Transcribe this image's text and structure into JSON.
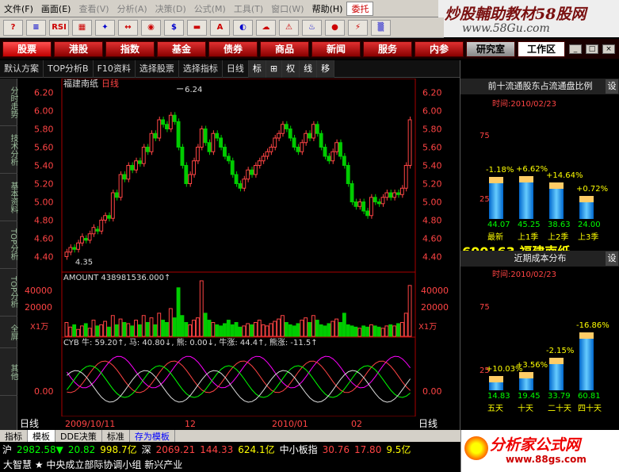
{
  "menu": [
    "文件(F)",
    "画面(E)",
    "查看(V)",
    "分析(A)",
    "决策(D)",
    "公式(M)",
    "工具(T)",
    "窗口(W)",
    "帮助(H)",
    "委托"
  ],
  "watermark": {
    "line1": "炒股輔助教材58股网",
    "line2": "www.58Gu.com"
  },
  "toolbar": {
    "icons": [
      "?",
      "≡",
      "RSI",
      "▦",
      "✦",
      "↔",
      "◉",
      "$",
      "▬",
      "A",
      "◐",
      "☁",
      "⚠",
      "♨",
      "●",
      "⚡",
      "▒"
    ]
  },
  "categories": [
    "股票",
    "港股",
    "指数",
    "基金",
    "债券",
    "商品",
    "新闻",
    "服务",
    "内参",
    "研究室",
    "工作区"
  ],
  "tabs": [
    "默认方案",
    "TOP分析B",
    "F10资料",
    "选择股票",
    "选择指标",
    "日线",
    "标",
    "⊞",
    "权",
    "线",
    "移"
  ],
  "left_side": [
    "分时走势",
    "技术分析",
    "基本资料",
    "TOP分析",
    "TOP分析",
    "全屏",
    "其他"
  ],
  "chart": {
    "stock_title": "福建南纸",
    "period": "日线",
    "max_label": "6.24",
    "min_label": "4.35",
    "price_axis": [
      "6.20",
      "6.00",
      "5.80",
      "5.60",
      "5.40",
      "5.20",
      "5.00",
      "4.80",
      "4.60",
      "4.40"
    ],
    "amount_label": "AMOUNT 438981536.000↑",
    "amount_axis": [
      "40000",
      "20000"
    ],
    "amount_unit": "X1万",
    "cyb_label": "CYB 牛: 59.20↑, 马: 40.80↓, 熊: 0.00↓, 牛涨: 44.4↑, 熊涨: -11.5↑",
    "cyb_axis": "0.00",
    "dates": [
      "2009/10/11",
      "12",
      "2010/01",
      "02"
    ],
    "daily_label": "日线"
  },
  "chart_data": {
    "type": "candlestick",
    "ylim": [
      4.3,
      6.3
    ],
    "candles": [
      [
        4.4,
        4.45
      ],
      [
        4.45,
        4.5
      ],
      [
        4.5,
        4.48
      ],
      [
        4.48,
        4.55
      ],
      [
        4.55,
        4.62
      ],
      [
        4.6,
        4.58
      ],
      [
        4.58,
        4.65
      ],
      [
        4.65,
        4.72
      ],
      [
        4.7,
        4.68
      ],
      [
        4.68,
        4.8
      ],
      [
        4.8,
        4.85
      ],
      [
        4.85,
        4.82
      ],
      [
        4.82,
        5.1
      ],
      [
        5.1,
        5.05
      ],
      [
        5.05,
        5.3
      ],
      [
        5.3,
        5.25
      ],
      [
        5.25,
        5.4
      ],
      [
        5.4,
        5.35
      ],
      [
        5.35,
        5.45
      ],
      [
        5.45,
        5.42
      ],
      [
        5.42,
        5.6
      ],
      [
        5.6,
        5.55
      ],
      [
        5.55,
        5.75
      ],
      [
        5.75,
        5.7
      ],
      [
        5.7,
        5.9
      ],
      [
        5.9,
        5.85
      ],
      [
        5.85,
        5.8
      ],
      [
        5.8,
        5.95
      ],
      [
        5.95,
        5.88
      ],
      [
        5.88,
        5.6
      ],
      [
        5.6,
        5.4
      ],
      [
        5.4,
        5.2
      ],
      [
        5.2,
        5.3
      ],
      [
        5.3,
        5.45
      ],
      [
        5.45,
        5.6
      ],
      [
        5.6,
        5.8
      ],
      [
        5.8,
        5.65
      ],
      [
        5.65,
        5.55
      ],
      [
        5.55,
        5.75
      ],
      [
        5.75,
        5.7
      ],
      [
        5.7,
        5.6
      ],
      [
        5.6,
        5.5
      ],
      [
        5.5,
        5.45
      ],
      [
        5.45,
        5.3
      ],
      [
        5.3,
        5.2
      ],
      [
        5.2,
        5.15
      ],
      [
        5.15,
        5.25
      ],
      [
        5.25,
        5.35
      ],
      [
        5.35,
        5.3
      ],
      [
        5.3,
        5.4
      ],
      [
        5.4,
        5.45
      ],
      [
        5.45,
        5.5
      ],
      [
        5.5,
        5.55
      ],
      [
        5.55,
        5.6
      ],
      [
        5.6,
        5.7
      ],
      [
        5.7,
        5.75
      ],
      [
        5.75,
        5.85
      ],
      [
        5.85,
        5.8
      ],
      [
        5.8,
        5.7
      ],
      [
        5.7,
        5.6
      ],
      [
        5.6,
        5.55
      ],
      [
        5.55,
        5.65
      ],
      [
        5.65,
        5.75
      ],
      [
        5.75,
        5.7
      ],
      [
        5.7,
        5.85
      ],
      [
        5.85,
        5.75
      ],
      [
        5.75,
        5.6
      ],
      [
        5.6,
        5.5
      ],
      [
        5.5,
        5.45
      ],
      [
        5.45,
        5.55
      ],
      [
        5.55,
        5.65
      ],
      [
        5.65,
        5.5
      ],
      [
        5.5,
        5.4
      ],
      [
        5.4,
        5.2
      ],
      [
        5.2,
        5.0
      ],
      [
        5.0,
        4.95
      ],
      [
        4.95,
        5.0
      ],
      [
        5.0,
        4.9
      ],
      [
        4.9,
        4.85
      ],
      [
        4.85,
        5.05
      ],
      [
        5.05,
        5.0
      ],
      [
        5.0,
        4.98
      ],
      [
        4.98,
        5.05
      ],
      [
        5.05,
        5.1
      ],
      [
        5.1,
        5.05
      ],
      [
        5.05,
        5.1
      ],
      [
        5.1,
        5.08
      ],
      [
        5.08,
        5.15
      ],
      [
        5.15,
        5.4
      ],
      [
        5.4,
        5.9
      ]
    ],
    "amount": [
      12,
      8,
      10,
      6,
      9,
      11,
      7,
      14,
      9,
      10,
      13,
      8,
      18,
      10,
      15,
      12,
      11,
      9,
      14,
      10,
      18,
      12,
      16,
      10,
      20,
      14,
      12,
      24,
      16,
      42,
      18,
      12,
      10,
      14,
      16,
      48,
      20,
      14,
      12,
      10,
      9,
      11,
      14,
      10,
      12,
      8,
      9,
      11,
      10,
      12,
      14,
      10,
      9,
      11,
      13,
      15,
      18,
      12,
      10,
      9,
      11,
      14,
      16,
      12,
      18,
      14,
      10,
      9,
      11,
      13,
      15,
      12,
      20,
      10,
      9,
      8,
      7,
      9,
      8,
      10,
      9,
      8,
      7,
      9,
      10,
      9,
      11,
      12,
      20,
      44
    ]
  },
  "right": {
    "panel1_title": "前十流通股东占流通盘比例",
    "panel1_set": "设",
    "panel1_time": "时间:2010/02/23",
    "panel1_axis": [
      "75",
      "25"
    ],
    "panel1_bars": [
      {
        "pct": "-1.18%",
        "val": "44.07",
        "lab": "最新"
      },
      {
        "pct": "+6.62%",
        "val": "45.25",
        "lab": "上1季"
      },
      {
        "pct": "+14.64%",
        "val": "38.63",
        "lab": "上2季"
      },
      {
        "pct": "+0.72%",
        "val": "24.00",
        "lab": "上3季"
      }
    ],
    "ratio": [
      "比",
      "例"
    ],
    "code": "600163",
    "name": "福建南纸",
    "panel2_title": "近期成本分布",
    "panel2_set": "设",
    "panel2_time": "时间:2010/02/23",
    "panel2_axis": [
      "75",
      "25"
    ],
    "panel2_bars": [
      {
        "pct": "+10.03%",
        "val": "14.83",
        "lab": "五天"
      },
      {
        "pct": "+3.56%",
        "val": "19.45",
        "lab": "十天"
      },
      {
        "pct": "-2.15%",
        "val": "33.79",
        "lab": "二十天"
      },
      {
        "pct": "-16.86%",
        "val": "60.81",
        "lab": "四十天"
      }
    ],
    "ratio2": [
      "比",
      "时"
    ]
  },
  "status": {
    "tabs": [
      "指标",
      "模板",
      "DDE决策",
      "标准",
      "存为模板"
    ],
    "row2": [
      {
        "t": "沪",
        "c": "#fff"
      },
      {
        "t": "2982.58▼",
        "c": "#0f0"
      },
      {
        "t": "20.82",
        "c": "#0f0"
      },
      {
        "t": "998.7亿",
        "c": "#ff0"
      },
      {
        "t": "深",
        "c": "#fff"
      },
      {
        "t": "2069.21",
        "c": "#f44"
      },
      {
        "t": "144.33",
        "c": "#f44"
      },
      {
        "t": "624.1亿",
        "c": "#ff0"
      },
      {
        "t": "中小板指",
        "c": "#fff"
      },
      {
        "t": "30.76",
        "c": "#f44"
      },
      {
        "t": "17.80",
        "c": "#f44"
      },
      {
        "t": "9.5亿",
        "c": "#ff0"
      }
    ],
    "row3": "大智慧  ★ 中央成立部际协调小组 新兴产业"
  },
  "logo": {
    "line1": "分析家公式网",
    "line2": "www.88gs.com"
  }
}
